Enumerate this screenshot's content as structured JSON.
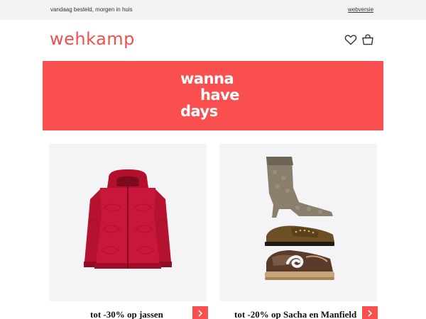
{
  "topbar": {
    "tagline": "vandaag besteld, morgen in huis",
    "web_version_link": "webversie"
  },
  "header": {
    "logo_text": "wehkamp",
    "icons": [
      "heart-icon",
      "shopping-bag-icon"
    ]
  },
  "banner": {
    "line1": "wanna",
    "line2": "have",
    "line3": "days"
  },
  "products": [
    {
      "caption": "tot -30% op jassen",
      "image": "red-puffer-jacket"
    },
    {
      "caption": "tot -20% op Sacha en Manfield",
      "image": "shoes-boot-loafer-sneaker"
    }
  ],
  "colors": {
    "brand": "#f0504b",
    "banner_bg": "#f94f4f",
    "topbar_bg": "#f2f2f4",
    "card_bg": "#f4f4f6"
  }
}
